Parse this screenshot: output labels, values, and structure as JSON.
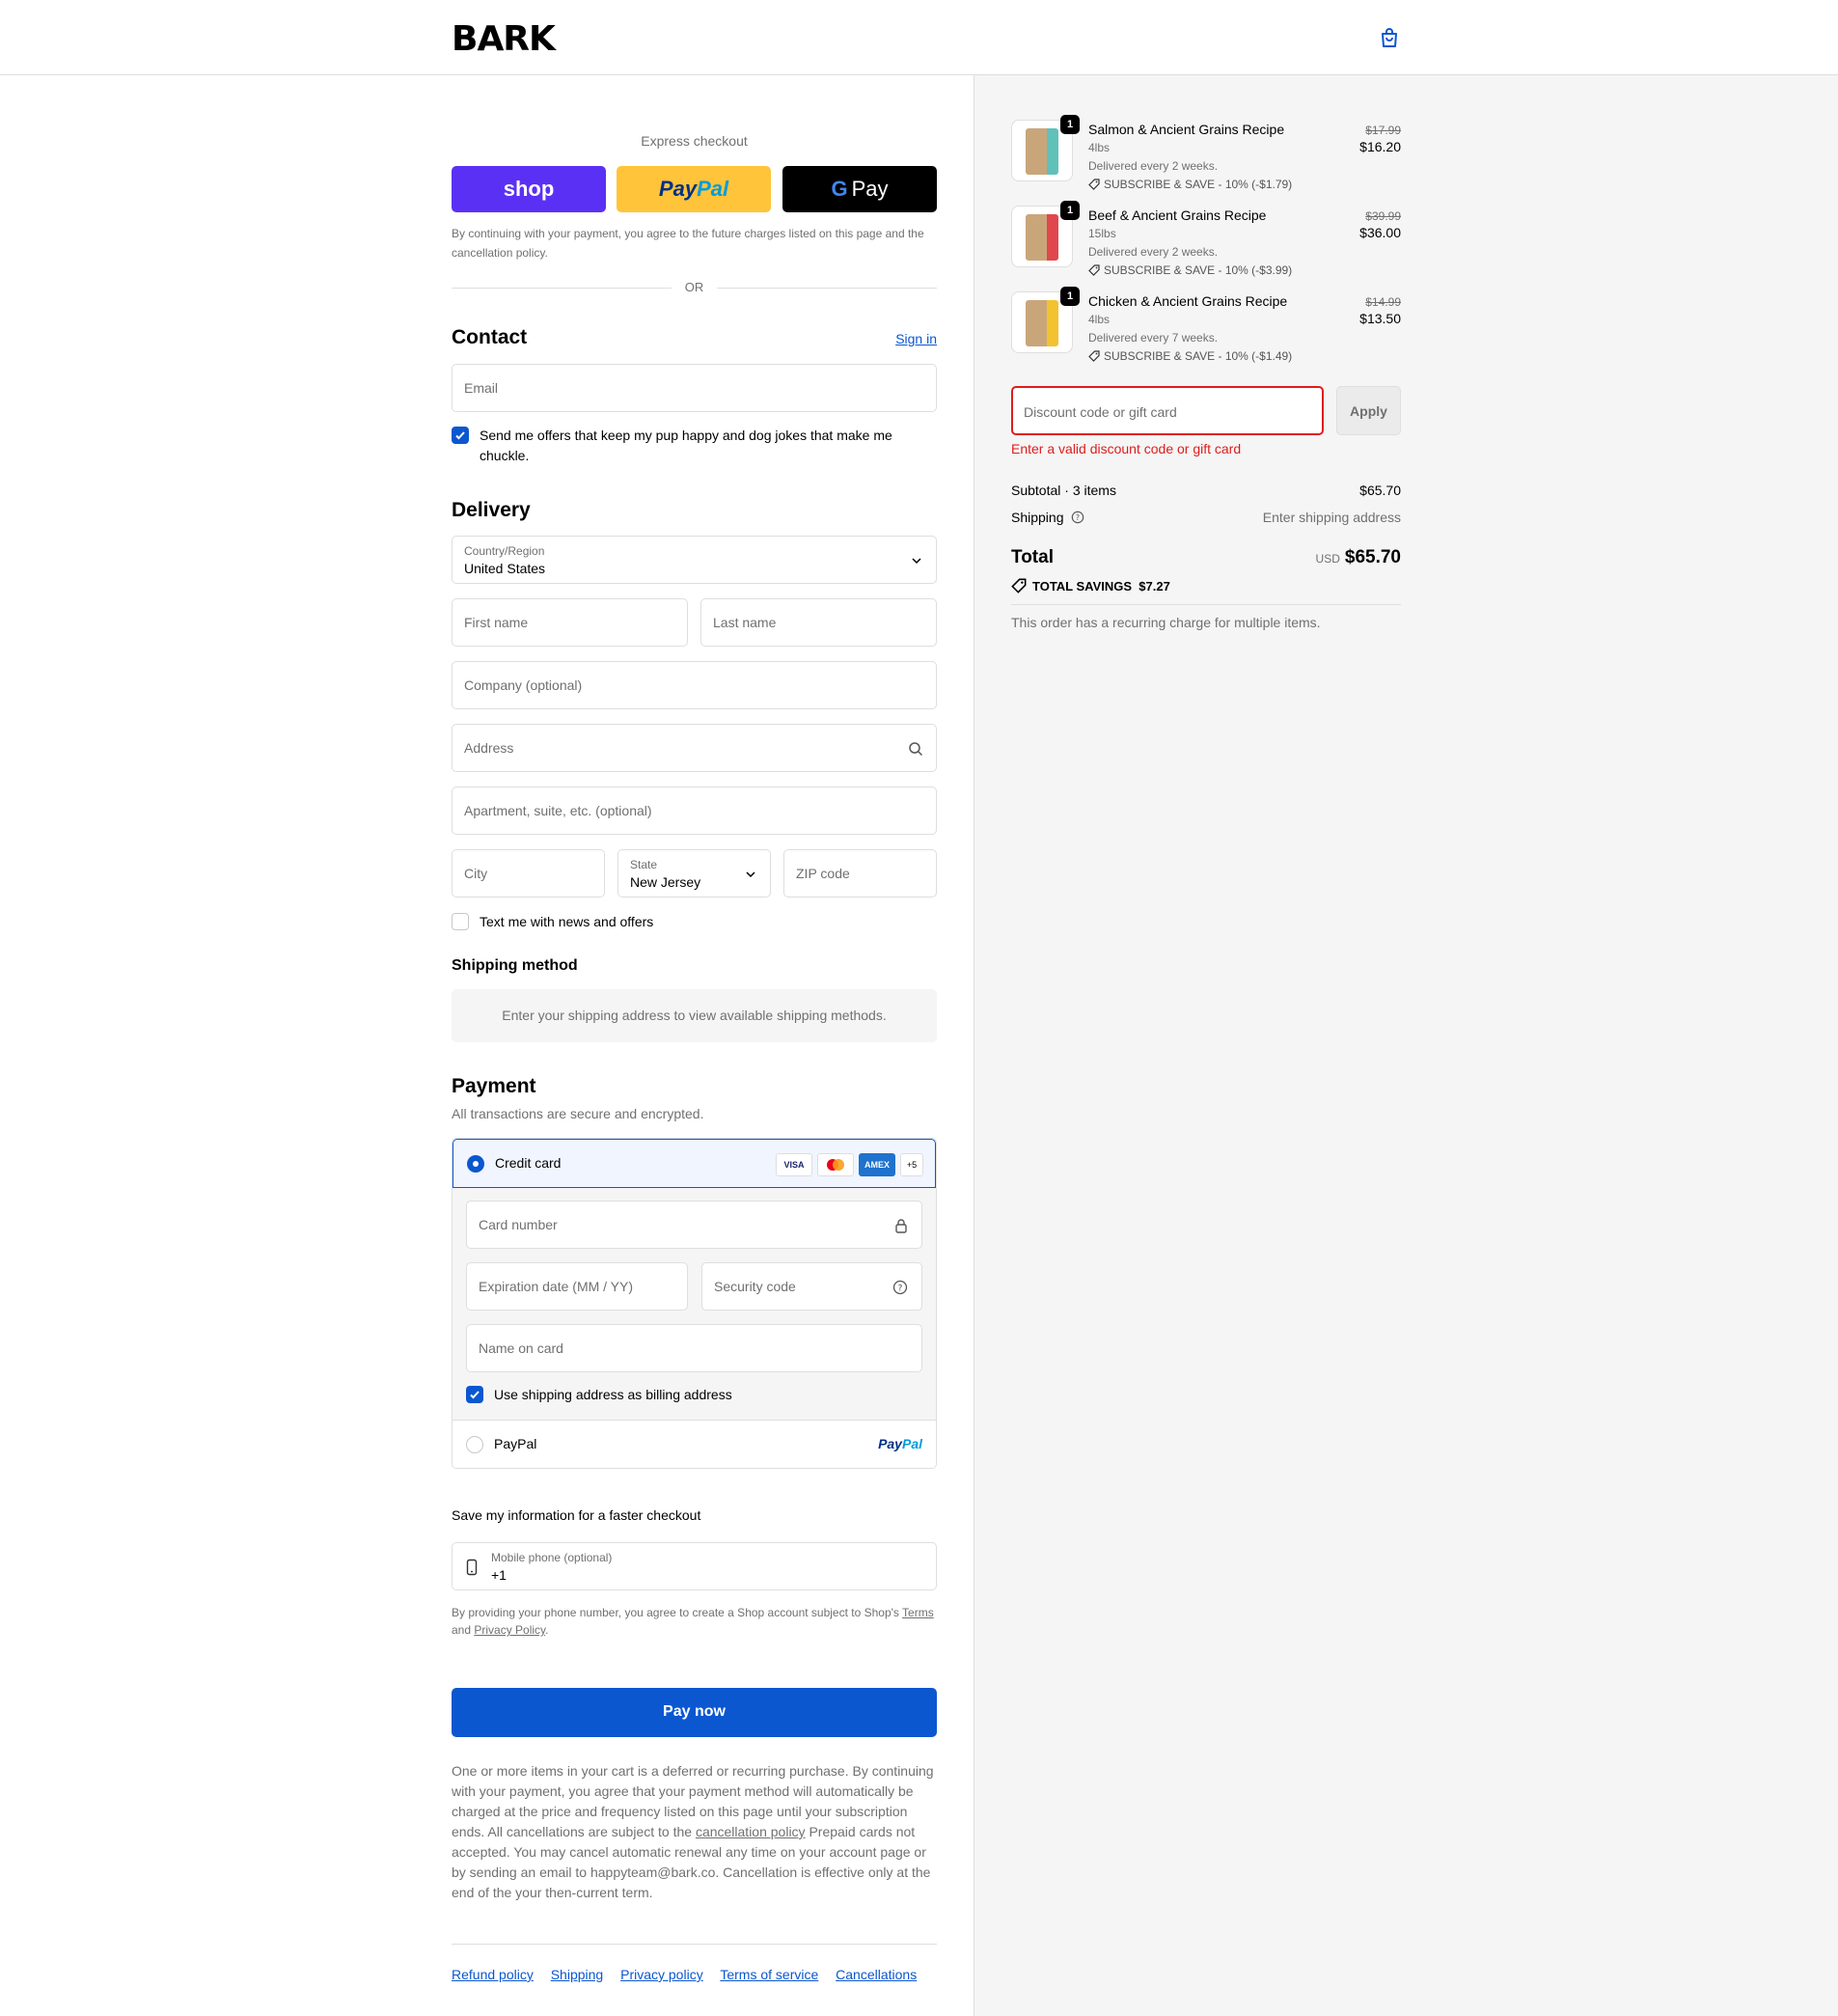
{
  "header": {
    "logo": "BARK"
  },
  "express": {
    "title": "Express checkout",
    "shop_label": "shop",
    "paypal_label_1": "Pay",
    "paypal_label_2": "Pal",
    "gpay_label": "Pay",
    "note": "By continuing with your payment, you agree to the future charges listed on this page and the cancellation policy.",
    "or": "OR"
  },
  "contact": {
    "title": "Contact",
    "sign_in": "Sign in",
    "email_placeholder": "Email",
    "offers_label": "Send me offers that keep my pup happy and dog jokes that make me chuckle.",
    "offers_checked": true
  },
  "delivery": {
    "title": "Delivery",
    "country_label": "Country/Region",
    "country_value": "United States",
    "first_name": "First name",
    "last_name": "Last name",
    "company": "Company (optional)",
    "address": "Address",
    "apartment": "Apartment, suite, etc. (optional)",
    "city": "City",
    "state_label": "State",
    "state_value": "New Jersey",
    "zip": "ZIP code",
    "sms_label": "Text me with news and offers",
    "sms_checked": false
  },
  "shipping_method": {
    "title": "Shipping method",
    "message": "Enter your shipping address to view available shipping methods."
  },
  "payment": {
    "title": "Payment",
    "subtitle": "All transactions are secure and encrypted.",
    "credit_card_label": "Credit card",
    "card_logos": [
      "VISA",
      "MC",
      "AMEX",
      "+5"
    ],
    "card_number": "Card number",
    "expiration": "Expiration date (MM / YY)",
    "security_code": "Security code",
    "name_on_card": "Name on card",
    "billing_label": "Use shipping address as billing address",
    "billing_checked": true,
    "paypal_label": "PayPal",
    "paypal_logo_1": "Pay",
    "paypal_logo_2": "Pal"
  },
  "save_info": {
    "title": "Save my information for a faster checkout",
    "phone_label": "Mobile phone (optional)",
    "phone_value": "+1",
    "note_1": "By providing your phone number, you agree to create a Shop account subject to Shop's ",
    "terms": "Terms",
    "note_2": "and ",
    "privacy": "Privacy Policy",
    "note_3": "."
  },
  "pay_now": "Pay now",
  "legal": {
    "text_1": "One or more items in your cart is a deferred or recurring purchase. By continuing with your payment, you agree that your payment method will automatically be charged at the price and frequency listed on this page until your subscription ends. All cancellations are subject to the ",
    "link": "cancellation policy",
    "text_2": " Prepaid cards not accepted. You may cancel automatic renewal any time on your account page or by sending an email to happyteam@bark.co. Cancellation is effective only at the end of the your then-current term."
  },
  "footer_links": [
    "Refund policy",
    "Shipping",
    "Privacy policy",
    "Terms of service",
    "Cancellations"
  ],
  "cart": {
    "items": [
      {
        "qty": "1",
        "name": "Salmon & Ancient Grains Recipe",
        "size": "4lbs",
        "frequency": "Delivered every 2 weeks.",
        "discount": "SUBSCRIBE & SAVE - 10% (-$1.79)",
        "old_price": "$17.99",
        "price": "$16.20",
        "color": "#5fc1b8"
      },
      {
        "qty": "1",
        "name": "Beef & Ancient Grains Recipe",
        "size": "15lbs",
        "frequency": "Delivered every 2 weeks.",
        "discount": "SUBSCRIBE & SAVE - 10% (-$3.99)",
        "old_price": "$39.99",
        "price": "$36.00",
        "color": "#e0474c"
      },
      {
        "qty": "1",
        "name": "Chicken & Ancient Grains Recipe",
        "size": "4lbs",
        "frequency": "Delivered every 7 weeks.",
        "discount": "SUBSCRIBE & SAVE - 10% (-$1.49)",
        "old_price": "$14.99",
        "price": "$13.50",
        "color": "#f2c230"
      }
    ],
    "discount_placeholder": "Discount code or gift card",
    "apply": "Apply",
    "error": "Enter a valid discount code or gift card",
    "subtotal_label": "Subtotal · 3 items",
    "subtotal_value": "$65.70",
    "shipping_label": "Shipping",
    "shipping_value": "Enter shipping address",
    "total_label": "Total",
    "currency": "USD",
    "total_value": "$65.70",
    "savings_label": "TOTAL SAVINGS",
    "savings_value": "$7.27",
    "recurring_note": "This order has a recurring charge for multiple items."
  },
  "colors": {
    "accent": "#0b57d0",
    "error": "#dd1d1d",
    "shop": "#5a31f4",
    "paypal": "#ffc439"
  }
}
